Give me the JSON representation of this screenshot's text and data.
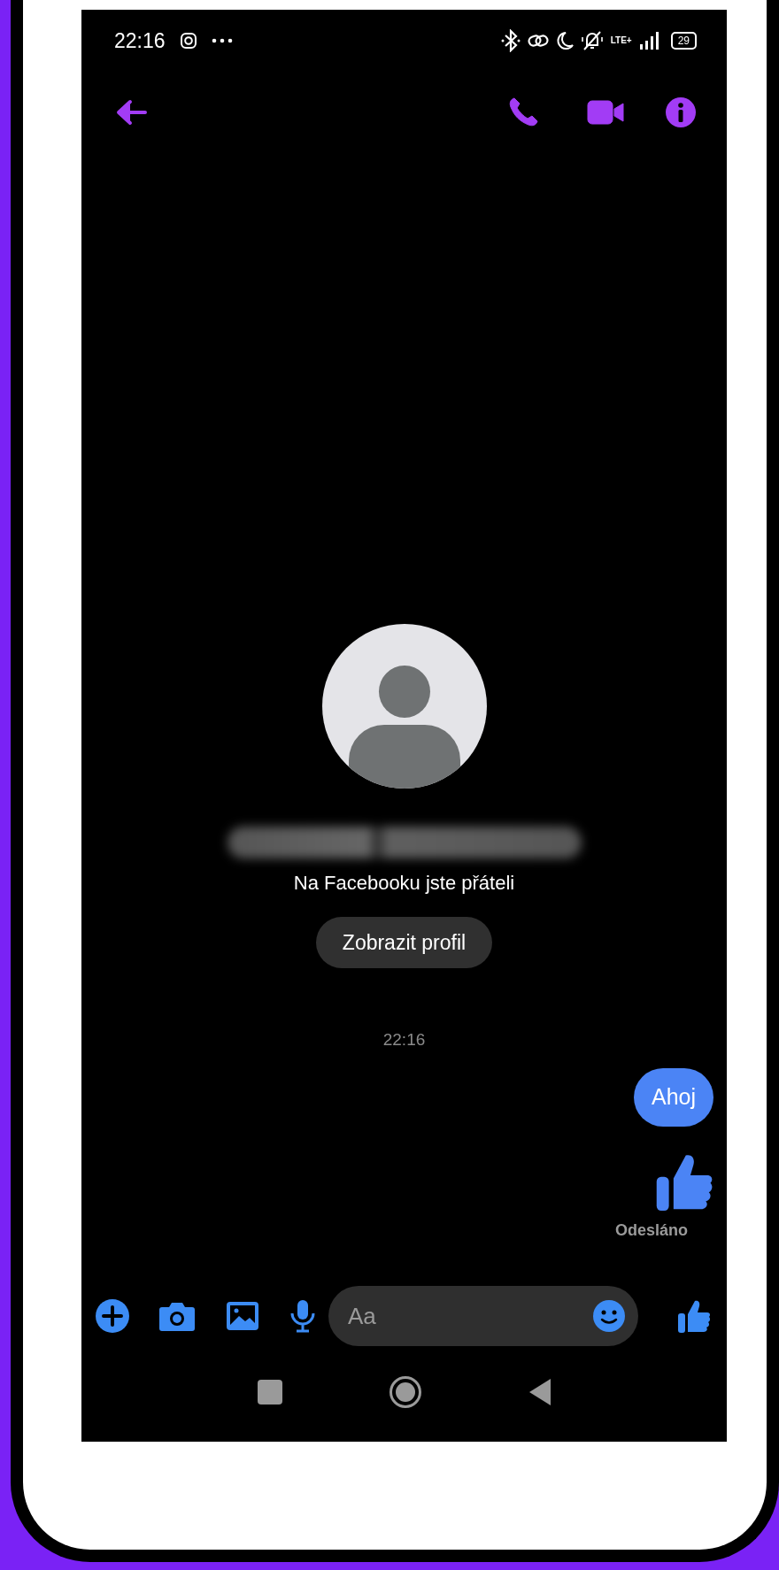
{
  "status_bar": {
    "time": "22:16",
    "network": "LTE+",
    "battery": "29"
  },
  "conversation": {
    "friend_note": "Na Facebooku jste přáteli",
    "profile_button": "Zobrazit profil",
    "timestamp": "22:16"
  },
  "messages": [
    {
      "kind": "text",
      "text": "Ahoj"
    },
    {
      "kind": "like"
    }
  ],
  "delivery_status": "Odesláno",
  "composer": {
    "placeholder": "Aa"
  }
}
